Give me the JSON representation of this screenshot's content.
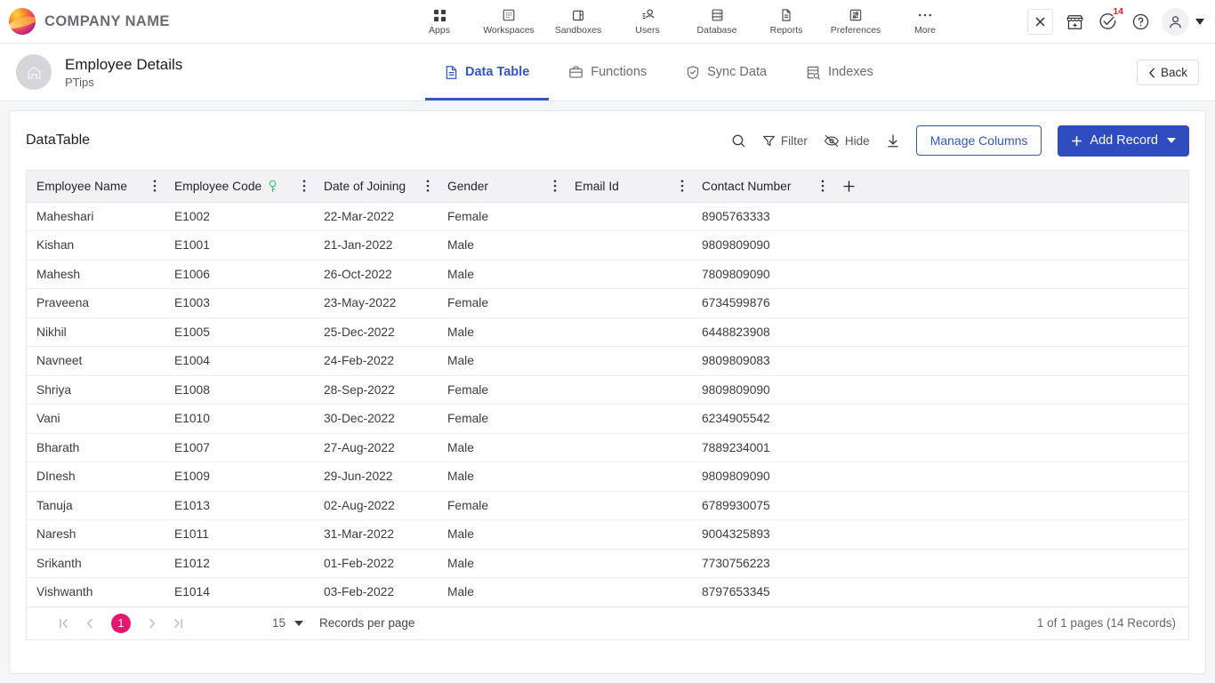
{
  "brand": {
    "name": "COMPANY NAME",
    "logo_icon": "company-sphere-logo"
  },
  "topnav": {
    "items": [
      {
        "label": "Apps",
        "icon": "apps-grid-icon"
      },
      {
        "label": "Workspaces",
        "icon": "workspaces-icon"
      },
      {
        "label": "Sandboxes",
        "icon": "sandboxes-icon"
      },
      {
        "label": "Users",
        "icon": "users-icon"
      },
      {
        "label": "Database",
        "icon": "database-icon"
      },
      {
        "label": "Reports",
        "icon": "reports-document-icon"
      },
      {
        "label": "Preferences",
        "icon": "preferences-sliders-icon"
      },
      {
        "label": "More",
        "icon": "more-ellipsis-icon"
      }
    ],
    "right": {
      "close_icon": "close-x-icon",
      "marketplace_icon": "marketplace-store-icon",
      "tasks_icon": "check-circle-icon",
      "tasks_badge": "14",
      "help_icon": "help-question-icon",
      "avatar_icon": "user-avatar-icon",
      "avatar_caret": "chevron-down-icon"
    }
  },
  "subheader": {
    "home_icon": "home-icon",
    "title": "Employee Details",
    "subtitle": "PTips",
    "back_label": "Back",
    "tabs": [
      {
        "label": "Data Table",
        "icon": "data-table-icon",
        "active": true
      },
      {
        "label": "Functions",
        "icon": "functions-briefcase-icon",
        "active": false
      },
      {
        "label": "Sync Data",
        "icon": "sync-shield-icon",
        "active": false
      },
      {
        "label": "Indexes",
        "icon": "indexes-search-icon",
        "active": false
      }
    ]
  },
  "toolbar": {
    "title": "DataTable",
    "search_icon": "search-icon",
    "filter_label": "Filter",
    "filter_icon": "filter-funnel-icon",
    "hide_label": "Hide",
    "hide_icon": "hide-eye-slash-icon",
    "download_icon": "download-icon",
    "manage_columns_label": "Manage Columns",
    "add_record_label": "Add Record",
    "add_record_caret": "chevron-down-icon",
    "accent_blue": "#2e4bbf"
  },
  "table": {
    "columns": [
      {
        "label": "Employee Name",
        "key_badge": false
      },
      {
        "label": "Employee Code",
        "key_badge": true
      },
      {
        "label": "Date of Joining",
        "key_badge": false
      },
      {
        "label": "Gender",
        "key_badge": false
      },
      {
        "label": "Email Id",
        "key_badge": false
      },
      {
        "label": "Contact Number",
        "key_badge": false
      }
    ],
    "add_column_icon": "plus-icon",
    "rows": [
      {
        "name": "Maheshari",
        "code": "E1002",
        "doj": "22-Mar-2022",
        "gender": "Female",
        "email": "",
        "contact": "8905763333"
      },
      {
        "name": "Kishan",
        "code": "E1001",
        "doj": "21-Jan-2022",
        "gender": "Male",
        "email": "",
        "contact": "9809809090"
      },
      {
        "name": "Mahesh",
        "code": "E1006",
        "doj": "26-Oct-2022",
        "gender": "Male",
        "email": "",
        "contact": "7809809090"
      },
      {
        "name": "Praveena",
        "code": "E1003",
        "doj": "23-May-2022",
        "gender": "Female",
        "email": "",
        "contact": "6734599876"
      },
      {
        "name": "Nikhil",
        "code": "E1005",
        "doj": "25-Dec-2022",
        "gender": "Male",
        "email": "",
        "contact": "6448823908"
      },
      {
        "name": "Navneet",
        "code": "E1004",
        "doj": "24-Feb-2022",
        "gender": "Male",
        "email": "",
        "contact": "9809809083"
      },
      {
        "name": "Shriya",
        "code": "E1008",
        "doj": "28-Sep-2022",
        "gender": "Female",
        "email": "",
        "contact": "9809809090"
      },
      {
        "name": "Vani",
        "code": "E1010",
        "doj": "30-Dec-2022",
        "gender": "Female",
        "email": "",
        "contact": "6234905542"
      },
      {
        "name": "Bharath",
        "code": "E1007",
        "doj": "27-Aug-2022",
        "gender": "Male",
        "email": "",
        "contact": "7889234001"
      },
      {
        "name": "DInesh",
        "code": "E1009",
        "doj": "29-Jun-2022",
        "gender": "Male",
        "email": "",
        "contact": "9809809090"
      },
      {
        "name": "Tanuja",
        "code": "E1013",
        "doj": "02-Aug-2022",
        "gender": "Female",
        "email": "",
        "contact": "6789930075"
      },
      {
        "name": "Naresh",
        "code": "E1011",
        "doj": "31-Mar-2022",
        "gender": "Male",
        "email": "",
        "contact": "9004325893"
      },
      {
        "name": "Srikanth",
        "code": "E1012",
        "doj": "01-Feb-2022",
        "gender": "Male",
        "email": "",
        "contact": "7730756223"
      },
      {
        "name": "Vishwanth",
        "code": "E1014",
        "doj": "03-Feb-2022",
        "gender": "Male",
        "email": "",
        "contact": "8797653345"
      }
    ]
  },
  "footer": {
    "first_icon": "first-page-icon",
    "prev_icon": "previous-page-icon",
    "current_page": "1",
    "next_icon": "next-page-icon",
    "last_icon": "last-page-icon",
    "page_size": "15",
    "page_size_label": "Records per page",
    "records_info": "1 of 1 pages (14 Records)",
    "active_page_color": "#e6166f"
  }
}
